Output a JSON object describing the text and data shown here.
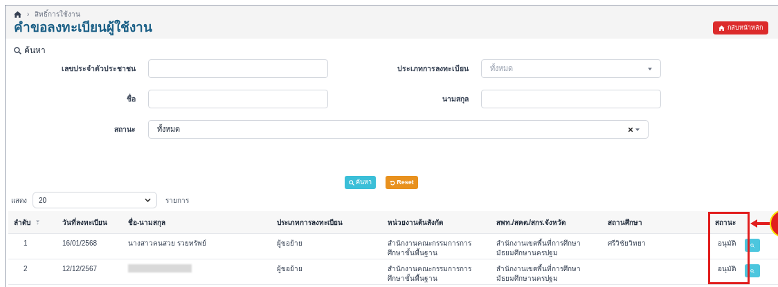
{
  "breadcrumb": {
    "separator": "›",
    "items": [
      "สิทธิ์การใช้งาน"
    ]
  },
  "title": "คำขอลงทะเบียนผู้ใช้งาน",
  "back_button": "กลับหน้าหลัก",
  "search": {
    "title": "ค้นหา",
    "fields": [
      {
        "label": "เลขประจำตัวประชาชน",
        "kind": "text"
      },
      {
        "label": "ประเภทการลงทะเบียน",
        "kind": "select",
        "placeholder": "ทั้งหมด"
      },
      {
        "label": "ชื่อ",
        "kind": "text"
      },
      {
        "label": "นามสกุล",
        "kind": "text"
      },
      {
        "label": "สถานะ",
        "kind": "clearable-select",
        "value": "ทั้งหมด"
      }
    ],
    "buttons": [
      {
        "label": "ค้นหา",
        "kind": "search"
      },
      {
        "label": "Reset",
        "kind": "reset"
      }
    ]
  },
  "page_size": {
    "label": "แสดง",
    "value": "20",
    "suffix": "รายการ"
  },
  "table": {
    "columns": [
      {
        "label": "ลำดับ",
        "sortable": true
      },
      {
        "label": "วันที่ลงทะเบียน",
        "sortable": false
      },
      {
        "label": "ชื่อ-นามสกุล",
        "sortable": false
      },
      {
        "label": "ประเภทการลงทะเบียน",
        "sortable": false
      },
      {
        "label": "หน่วยงานต้นสังกัด",
        "sortable": false
      },
      {
        "label": "สพท./สคต./สกร.จังหวัด",
        "sortable": false
      },
      {
        "label": "สถานศึกษา",
        "sortable": false
      },
      {
        "label": "สถานะ",
        "sortable": false
      }
    ],
    "rows": [
      {
        "no": "1",
        "date": "16/01/2568",
        "name": "นางสาวคนสวย รวยทรัพย์",
        "name_redacted": false,
        "type": "ผู้ขอย้าย",
        "unit": "สำนักงานคณะกรรมการการศึกษาขั้นพื้นฐาน",
        "area": "สำนักงานเขตพื้นที่การศึกษามัธยมศึกษานครปฐม",
        "school": "ศรีวิชัยวิทยา",
        "status": "อนุมัติ"
      },
      {
        "no": "2",
        "date": "12/12/2567",
        "name_redacted": true,
        "type": "ผู้ขอย้าย",
        "unit": "สำนักงานคณะกรรมการการศึกษาขั้นพื้นฐาน",
        "area": "สำนักงานเขตพื้นที่การศึกษามัธยมศึกษานครปฐม",
        "status": "อนุมัติ"
      }
    ]
  }
}
